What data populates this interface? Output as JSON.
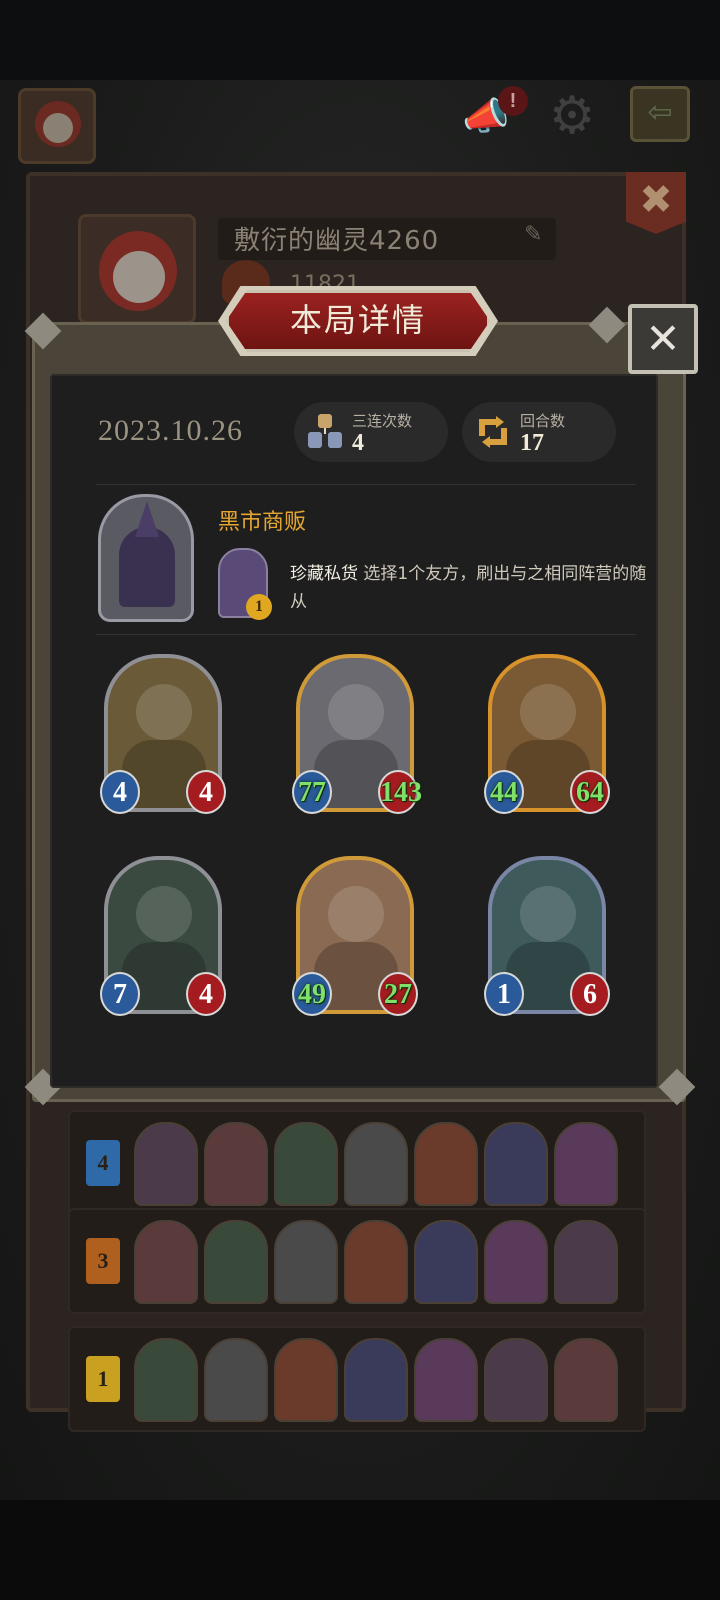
{
  "profile": {
    "player_name": "敷衍的幽灵4260",
    "score": "11821"
  },
  "history": {
    "rows": [
      {
        "rank": "4",
        "color": "#2e6aa8"
      },
      {
        "rank": "3",
        "color": "#b0601e"
      },
      {
        "rank": "1",
        "color": "#c9a020"
      }
    ]
  },
  "modal": {
    "title": "本局详情",
    "close_label": "✕",
    "date": "2023.10.26",
    "stats": {
      "triples_label": "三连次数",
      "triples_value": "4",
      "turns_label": "回合数",
      "turns_value": "17"
    },
    "hero": {
      "name": "黑市商贩",
      "power_name": "珍藏私货",
      "power_cost": "1",
      "power_desc": "选择1个友方，刷出与之相同阵营的随从"
    },
    "minions": [
      {
        "attack": "4",
        "health": "4",
        "frame": "#8f8f96",
        "art": "#6a5a38",
        "buffed": false
      },
      {
        "attack": "77",
        "health": "143",
        "frame": "#d09a38",
        "art": "#6a6a70",
        "buffed": true
      },
      {
        "attack": "44",
        "health": "64",
        "frame": "#d8922a",
        "art": "#7a5a34",
        "buffed": true
      },
      {
        "attack": "7",
        "health": "4",
        "frame": "#8f8f96",
        "art": "#3a4a40",
        "buffed": false
      },
      {
        "attack": "49",
        "health": "27",
        "frame": "#d09a38",
        "art": "#8a6a52",
        "buffed": true
      },
      {
        "attack": "1",
        "health": "6",
        "frame": "#7a86a6",
        "art": "#3e5a5a",
        "buffed": false
      }
    ]
  },
  "colors": {
    "accent_gold": "#e3a630",
    "title_red": "#9a2220",
    "buff_green": "#7fe06a"
  }
}
